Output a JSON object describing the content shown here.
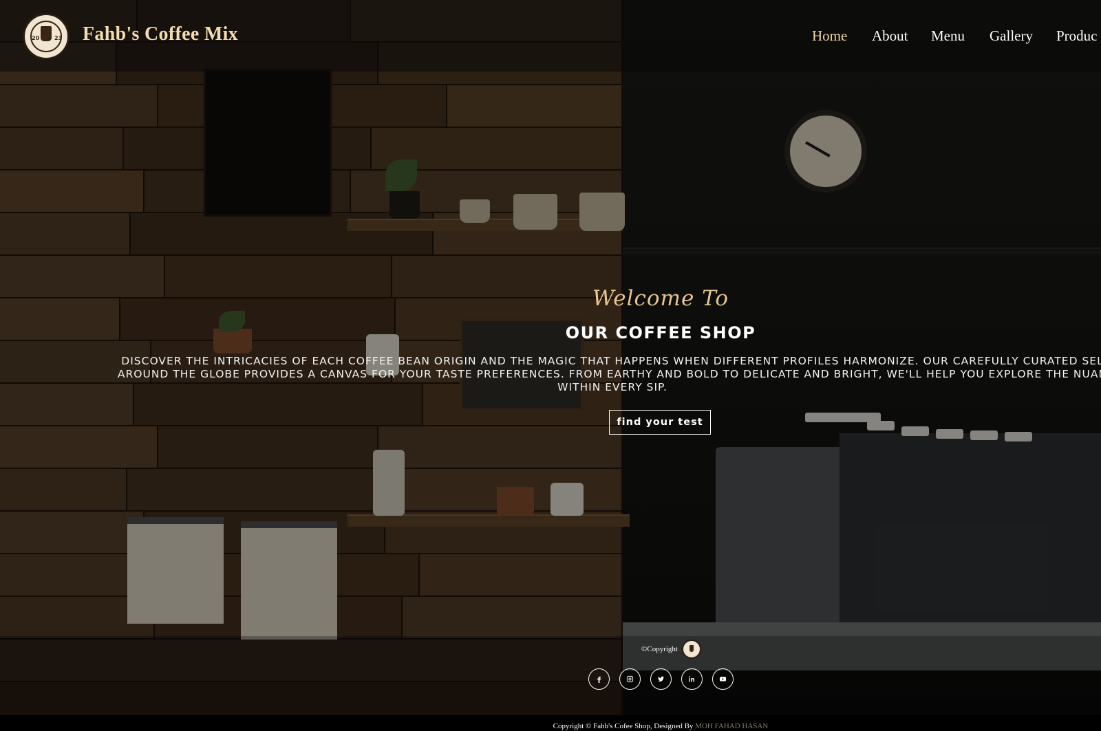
{
  "brand": {
    "name": "Fahb's Coffee Mix",
    "logo_year_left": "20",
    "logo_year_right": "23"
  },
  "nav": {
    "items": [
      {
        "label": "Home",
        "active": true
      },
      {
        "label": "About",
        "active": false
      },
      {
        "label": "Menu",
        "active": false
      },
      {
        "label": "Gallery",
        "active": false
      },
      {
        "label": "Produc",
        "active": false
      }
    ]
  },
  "hero": {
    "welcome": "Welcome To",
    "title": "OUR COFFEE SHOP",
    "line1": "DISCOVER THE INTRICACIES OF EACH COFFEE BEAN ORIGIN AND THE MAGIC THAT HAPPENS WHEN DIFFERENT PROFILES HARMONIZE. OUR CAREFULLY CURATED SEL",
    "line2": "AROUND THE GLOBE PROVIDES A CANVAS FOR YOUR TASTE PREFERENCES. FROM EARTHY AND BOLD TO DELICATE AND BRIGHT, WE'LL HELP YOU EXPLORE THE NUAN",
    "line3": "WITHIN EVERY SIP.",
    "cta_label": "find your test"
  },
  "footer": {
    "copyright": "©Copyright",
    "socials": [
      "facebook-icon",
      "instagram-icon",
      "twitter-icon",
      "linkedin-icon",
      "youtube-icon"
    ],
    "credit_prefix": "Copyright © Fahb's Cofee Shop, Designed By ",
    "credit_author": "MOH FAHAD HASAN"
  },
  "colors": {
    "brand_text": "#f3dcb0",
    "active_nav": "#f1d6a6",
    "welcome": "#e7c690"
  }
}
